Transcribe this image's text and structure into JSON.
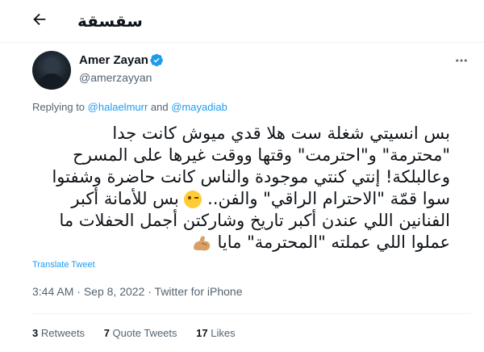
{
  "header": {
    "title": "سقسقة",
    "back_icon": "arrow-left-icon"
  },
  "author": {
    "display_name": "Amer Zayan",
    "handle": "@amerzayyan",
    "verified_icon": "verified-badge-icon",
    "verified_color": "#1d9bf0"
  },
  "reply": {
    "prefix": "Replying to",
    "mention1": "@halaelmurr",
    "and_text": "and",
    "mention2": "@mayadiab"
  },
  "tweet": {
    "lines": [
      "بس انسيتي شغلة ست هلا قدي ميوش كانت جدا",
      "\"محترمة\" و\"احترمت\" وقتها ووقت غيرها على المسرح",
      "وعالبلكة! إنتي كنتي موجودة والناس كانت حاضرة وشفتوا",
      "سوا قمّة \"الاحترام الراقي\" والفن..",
      "بس للأمانة أكبر",
      "الفنانين اللي عندن أكبر تاريخ وشاركتن أجمل الحفلات ما",
      "عملوا اللي عملته \"المحترمة\" مايا"
    ],
    "emoji_wink": "winking-face-icon",
    "emoji_arm": "flexed-biceps-icon"
  },
  "translate_label": "Translate Tweet",
  "meta": {
    "time": "3:44 AM",
    "date": "Sep 8, 2022",
    "source": "Twitter for iPhone",
    "separator": "·"
  },
  "stats": {
    "retweets_count": "3",
    "retweets_label": "Retweets",
    "quotes_count": "7",
    "quotes_label": "Quote Tweets",
    "likes_count": "17",
    "likes_label": "Likes"
  },
  "colors": {
    "accent": "#1d9bf0",
    "secondary_text": "#536471",
    "primary_text": "#0f1419"
  }
}
